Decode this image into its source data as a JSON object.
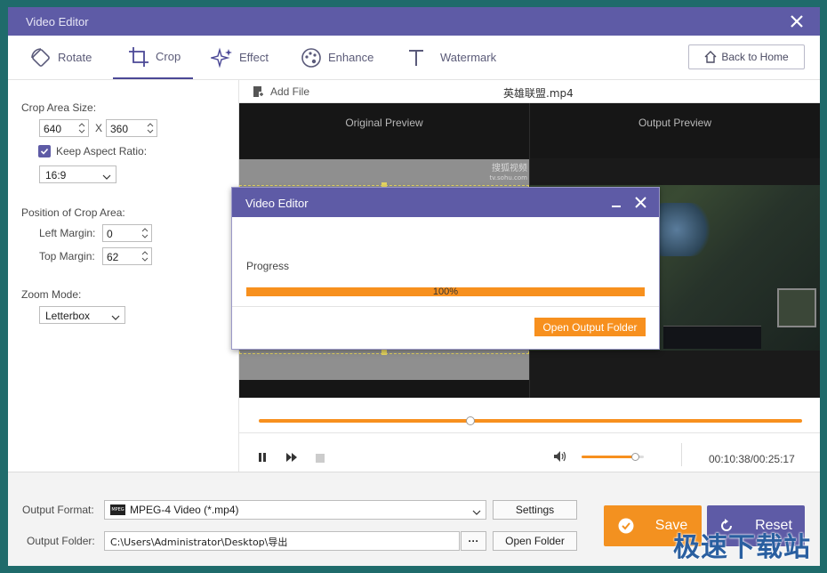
{
  "window": {
    "title": "Video Editor"
  },
  "tabs": [
    {
      "label": "Rotate",
      "icon": "rotate-icon"
    },
    {
      "label": "Crop",
      "icon": "crop-icon"
    },
    {
      "label": "Effect",
      "icon": "effect-icon"
    },
    {
      "label": "Enhance",
      "icon": "enhance-icon"
    },
    {
      "label": "Watermark",
      "icon": "watermark-icon"
    }
  ],
  "active_tab": "Crop",
  "back_home": {
    "label": "Back to Home",
    "icon": "home-icon"
  },
  "crop": {
    "area_size_label": "Crop Area Size:",
    "width": "640",
    "x_label": "X",
    "height": "360",
    "keep_aspect_label": "Keep Aspect Ratio:",
    "keep_aspect_checked": true,
    "aspect_ratio": "16:9",
    "position_label": "Position of Crop Area:",
    "left_margin_label": "Left Margin:",
    "left_margin": "0",
    "top_margin_label": "Top Margin:",
    "top_margin": "62",
    "zoom_mode_label": "Zoom Mode:",
    "zoom_mode": "Letterbox"
  },
  "file": {
    "add_file_label": "Add File",
    "filename": "英雄联盟.mp4"
  },
  "preview": {
    "original_label": "Original Preview",
    "output_label": "Output Preview",
    "source_watermark": "搜狐视频",
    "source_watermark_url": "tv.sohu.com"
  },
  "player": {
    "seek_fraction": 0.39,
    "volume_fraction": 0.85,
    "time": "00:10:38/00:25:17"
  },
  "output": {
    "format_label": "Output Format:",
    "format_value": "MPEG-4 Video (*.mp4)",
    "format_icon_text": "MPEG",
    "settings_label": "Settings",
    "folder_label": "Output Folder:",
    "folder_value": "C:\\Users\\Administrator\\Desktop\\导出",
    "browse_label": "···",
    "open_folder_label": "Open Folder"
  },
  "actions": {
    "save_label": "Save",
    "reset_label": "Reset"
  },
  "dialog": {
    "title": "Video Editor",
    "progress_label": "Progress",
    "progress_text": "100%",
    "progress_fraction": 1.0,
    "open_output_label": "Open Output Folder"
  },
  "site_watermark": "极速下载站",
  "colors": {
    "accent": "#5e5ba6",
    "orange": "#f7901e",
    "save_button": "#f39120",
    "reset_button": "#5e5ba6"
  }
}
